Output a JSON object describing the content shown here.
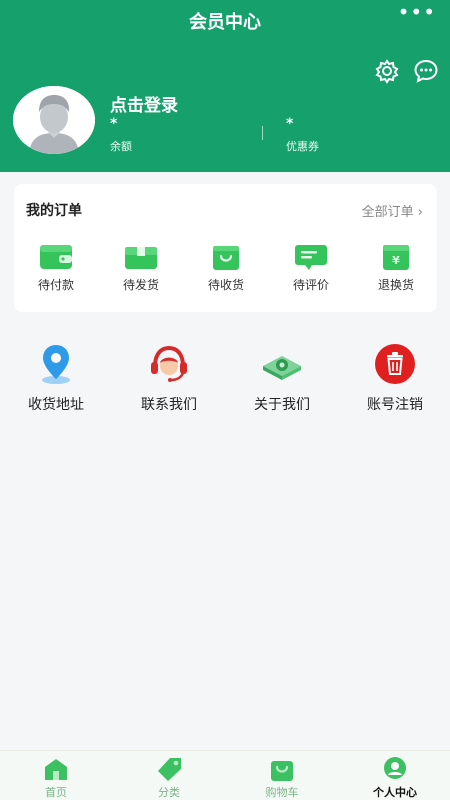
{
  "header": {
    "title": "会员中心",
    "more": "•••"
  },
  "profile": {
    "login_text": "点击登录",
    "balance": {
      "value": "*",
      "label": "余额"
    },
    "coupons": {
      "value": "*",
      "label": "优惠券"
    }
  },
  "orders": {
    "title": "我的订单",
    "view_all": "全部订单 ›",
    "items": [
      {
        "label": "待付款",
        "icon": "wallet-icon"
      },
      {
        "label": "待发货",
        "icon": "package-icon"
      },
      {
        "label": "待收货",
        "icon": "shopping-bag-icon"
      },
      {
        "label": "待评价",
        "icon": "review-icon"
      },
      {
        "label": "退换货",
        "icon": "refund-icon"
      }
    ]
  },
  "services": [
    {
      "label": "收货地址",
      "icon": "location-pin-icon"
    },
    {
      "label": "联系我们",
      "icon": "headset-icon"
    },
    {
      "label": "关于我们",
      "icon": "about-icon"
    },
    {
      "label": "账号注销",
      "icon": "trash-icon"
    }
  ],
  "tabbar": {
    "items": [
      {
        "label": "首页",
        "icon": "home-icon"
      },
      {
        "label": "分类",
        "icon": "tag-icon"
      },
      {
        "label": "购物车",
        "icon": "cart-bag-icon"
      },
      {
        "label": "个人中心",
        "icon": "user-icon",
        "active": true
      }
    ]
  },
  "colors": {
    "brand": "#16a06c",
    "accent_green": "#2fc15c",
    "danger": "#e02020"
  }
}
